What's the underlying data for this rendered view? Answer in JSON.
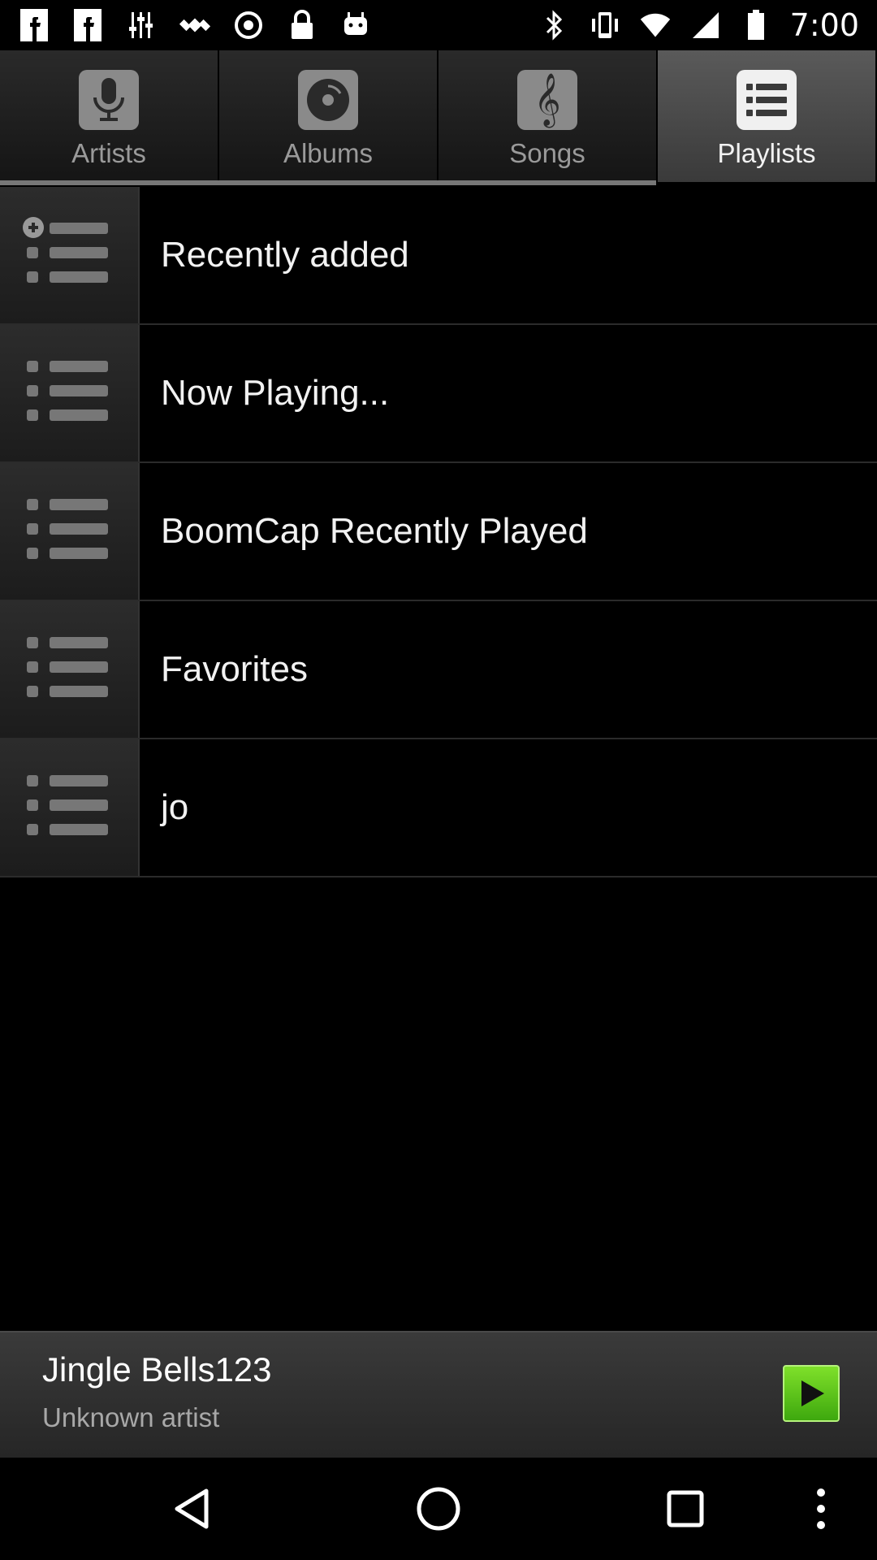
{
  "statusbar": {
    "time": "7:00",
    "left_icons": [
      "facebook-icon",
      "facebook-icon",
      "equalizer-icon",
      "satellite-icon",
      "circle-icon",
      "lock-icon",
      "android-icon"
    ],
    "right_icons": [
      "bluetooth-icon",
      "vibrate-icon",
      "wifi-icon",
      "signal-icon",
      "battery-icon"
    ]
  },
  "tabs": [
    {
      "label": "Artists",
      "icon": "microphone-icon",
      "active": false
    },
    {
      "label": "Albums",
      "icon": "disc-icon",
      "active": false
    },
    {
      "label": "Songs",
      "icon": "treble-clef-icon",
      "active": false
    },
    {
      "label": "Playlists",
      "icon": "list-icon",
      "active": true
    }
  ],
  "playlists": [
    {
      "label": "Recently added",
      "icon": "add-list-icon"
    },
    {
      "label": "Now Playing...",
      "icon": "list-icon"
    },
    {
      "label": "BoomCap Recently Played",
      "icon": "list-icon"
    },
    {
      "label": "Favorites",
      "icon": "list-icon"
    },
    {
      "label": "jo",
      "icon": "list-icon"
    }
  ],
  "now_playing": {
    "title": "Jingle Bells123",
    "artist": "Unknown artist",
    "play_color": "#5cc81b"
  },
  "navbar": {
    "icons": [
      "back-icon",
      "home-icon",
      "recents-icon",
      "overflow-menu-icon"
    ]
  }
}
